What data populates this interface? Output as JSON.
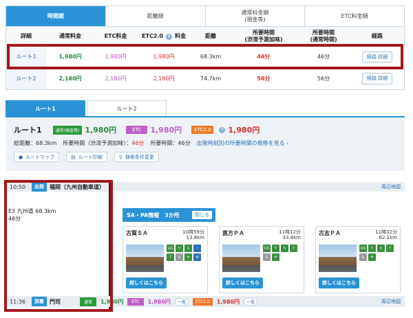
{
  "sort_tabs": [
    "時間順",
    "距離順",
    "通常料金順\n(現金等)",
    "ETC料金順"
  ],
  "table": {
    "headers": [
      "詳細",
      "通常料金",
      "ETC料金",
      "ETC2.0",
      "料金",
      "距離",
      "所要時間\n(渋滞予測加味)",
      "所要時間\n(通常時間)",
      "経路"
    ],
    "rows": [
      {
        "name": "ルート1",
        "normal": "1,980円",
        "etc": "1,980円",
        "etc2": "1,980円",
        "dist": "68.3km",
        "time_jam": "46分",
        "time_normal": "46分",
        "btn": "経路 詳細"
      },
      {
        "name": "ルート2",
        "normal": "2,180円",
        "etc": "2,180円",
        "etc2": "2,180円",
        "dist": "74.7km",
        "time_jam": "56分",
        "time_normal": "56分",
        "btn": "経路 詳細"
      }
    ]
  },
  "route_tabs": [
    "ルート1",
    "ルート2"
  ],
  "summary": {
    "title": "ルート1",
    "badge_normal": "通常(現金等)",
    "price_normal": "1,980円",
    "badge_etc": "ETC",
    "price_etc": "1,980円",
    "badge_etc2": "ETC2.0",
    "price_etc2": "1,980円",
    "distance": "総距離：68.3km",
    "time_jam_label": "所要時間（渋滞予測加味）：",
    "time_jam": "46分",
    "time_normal": "所要時間：46分",
    "trend_link": "出発時刻別の所要時間の推移を見る",
    "buttons": [
      "ルートマップ",
      "ルート印刷",
      "検索条件変更"
    ]
  },
  "detail": {
    "start_time": "10:50",
    "start_tag": "出発",
    "start_place": "福岡（九州自動車道）",
    "map_link": "周辺地図",
    "road": "E3 九州道 68.3km",
    "road_time": "46分",
    "sa_header": "SA・PA情報",
    "sa_count": "3か所",
    "sa_close": "閉じる",
    "sa": [
      {
        "name": "古賀ＳＡ",
        "time": "10時59分",
        "dist": "13.8km",
        "btn": "詳しくはこちら"
      },
      {
        "name": "直方ＰＡ",
        "time": "11時12分",
        "dist": "33.4km",
        "btn": "詳しくはこちら"
      },
      {
        "name": "古志ＰＡ",
        "time": "11時32分",
        "dist": "62.1km",
        "btn": "詳しくはこちら"
      }
    ],
    "end_time": "11:36",
    "end_tag": "到着",
    "end_place": "門司",
    "fare_normal_badge": "通常",
    "fare_normal": "1,980円",
    "fare_etc_badge": "ETC",
    "fare_etc": "1,980円",
    "fare_list": "一覧",
    "fare_etc2_badge": "ETC2.0",
    "fare_etc2": "1,980円",
    "fare_list2": "一覧",
    "end_map_link": "周辺地図"
  }
}
